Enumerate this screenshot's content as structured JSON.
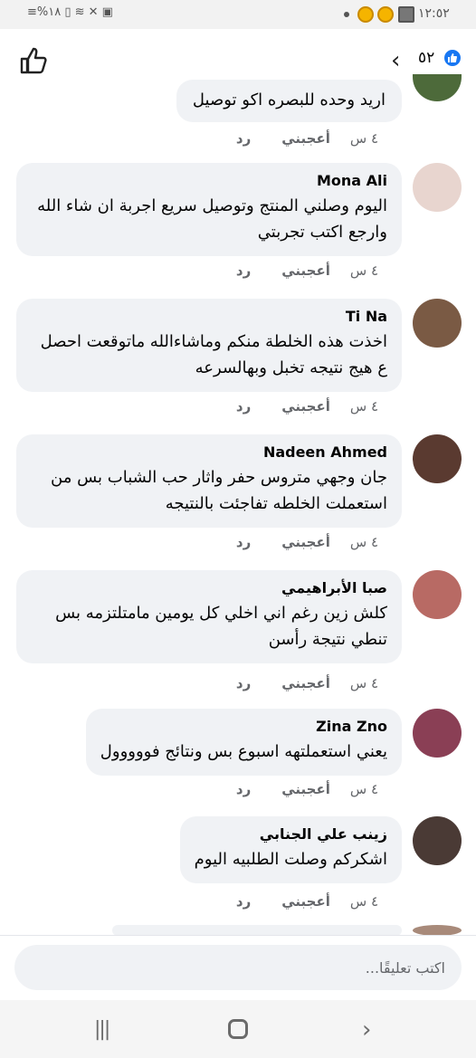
{
  "status_bar": {
    "time": "١٢:٥٢",
    "left_indicators": "≡%١٨ ▯ ≋ ✕ ▣"
  },
  "header": {
    "reaction_count": "٥٢"
  },
  "top_comment": {
    "text": "اريد وحده للبصره اكو توصيل",
    "time": "٤ س",
    "like": "أعجبني",
    "reply": "رد"
  },
  "comments": [
    {
      "author": "Mona Ali",
      "text": "اليوم وصلني المنتج وتوصيل سريع اجربة ان شاء الله وارجع اكتب تجربتي",
      "time": "٤ س",
      "like": "أعجبني",
      "reply": "رد",
      "avatar_color": "#e8d5cf"
    },
    {
      "author": "Ti Na",
      "text": "اخذت هذه الخلطة منكم وماشاءالله ماتوقعت احصل ع هيج نتيجه تخبل وبهالسرعه",
      "time": "٤ س",
      "like": "أعجبني",
      "reply": "رد",
      "avatar_color": "#7a5a44"
    },
    {
      "author": "Nadeen Ahmed",
      "text": "جان وجهي متروس حفر واثار حب الشباب بس من استعملت الخلطه تفاجئت بالنتيجه",
      "time": "٤ س",
      "like": "أعجبني",
      "reply": "رد",
      "avatar_color": "#5a3a30"
    },
    {
      "author": "صبا الأبراهيمي",
      "text": "كلش زين رغم اني اخلي كل يومين مامتلتزمه بس تنطي نتيجة رأسن",
      "time": "٤ س",
      "like": "أعجبني",
      "reply": "رد",
      "avatar_color": "#b86a64"
    },
    {
      "author": "Zina Zno",
      "text": "يعني استعملتهه اسبوع بس ونتائج فووووول",
      "time": "٤ س",
      "like": "أعجبني",
      "reply": "رد",
      "avatar_color": "#8a3f55"
    },
    {
      "author": "زينب علي الجنابي",
      "text": "اشكركم وصلت الطلبيه اليوم",
      "time": "٤ س",
      "like": "أعجبني",
      "reply": "رد",
      "avatar_color": "#4a3a35"
    }
  ],
  "composer": {
    "placeholder": "اكتب تعليقًا..."
  },
  "colors": {
    "bubble": "#f0f2f5",
    "accent": "#1877f2",
    "meta_text": "#65676b"
  }
}
